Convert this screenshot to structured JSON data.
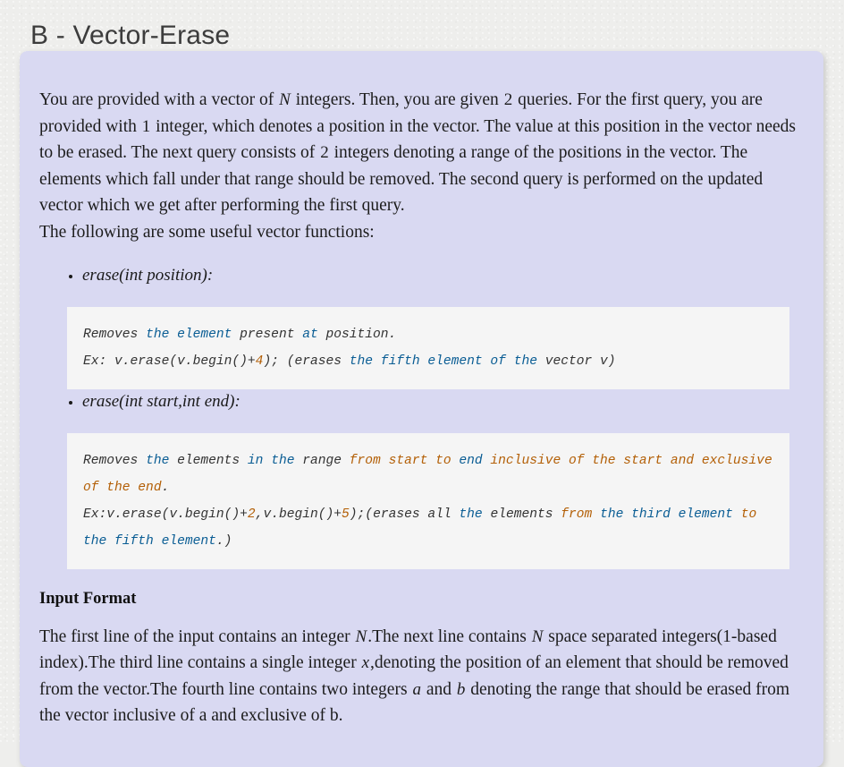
{
  "page": {
    "title": "B - Vector-Erase",
    "background_color": "#eeeeec",
    "panel_color": "#d9d9f2",
    "code_block_color": "#f5f5f5",
    "code_keyword_blue": "#0a5d94",
    "code_keyword_orange": "#b35f06"
  },
  "statement": {
    "p1_a": "You are provided with a vector of ",
    "p1_N": "N",
    "p1_b": " integers. Then, you are given ",
    "p1_2": "2",
    "p1_c": " queries. For the first query, you are provided with ",
    "p1_1": "1",
    "p1_d": " integer, which denotes a position in the vector. The value at this position in the vector needs to be erased. The next query consists of ",
    "p1_2b": "2",
    "p1_e": " integers denoting a range of the positions in the vector. The elements which fall under that range should be removed. The second query is performed on the updated vector which we get after performing the first query.",
    "p2": "The following are some useful vector functions:"
  },
  "functions": [
    {
      "signature": "erase(int position):",
      "code_lines": [
        [
          {
            "t": "Removes ",
            "c": "plain"
          },
          {
            "t": "the element ",
            "c": "blue"
          },
          {
            "t": "present ",
            "c": "plain"
          },
          {
            "t": "at ",
            "c": "blue"
          },
          {
            "t": "position.",
            "c": "plain"
          }
        ],
        [
          {
            "t": "Ex: v.erase(v.begin()+",
            "c": "plain"
          },
          {
            "t": "4",
            "c": "orange"
          },
          {
            "t": "); (erases ",
            "c": "plain"
          },
          {
            "t": "the fifth element of the ",
            "c": "blue"
          },
          {
            "t": "vector v)",
            "c": "plain"
          }
        ]
      ]
    },
    {
      "signature": "erase(int start,int end):",
      "code_lines": [
        [
          {
            "t": "Removes ",
            "c": "plain"
          },
          {
            "t": "the ",
            "c": "blue"
          },
          {
            "t": "elements ",
            "c": "plain"
          },
          {
            "t": "in the ",
            "c": "blue"
          },
          {
            "t": "range ",
            "c": "plain"
          },
          {
            "t": "from start to ",
            "c": "orange"
          },
          {
            "t": "end ",
            "c": "blue"
          },
          {
            "t": "inclusive of the start and exclusive of the end",
            "c": "orange"
          },
          {
            "t": ".",
            "c": "plain"
          }
        ],
        [
          {
            "t": "Ex:v.erase(v.begin()+",
            "c": "plain"
          },
          {
            "t": "2",
            "c": "orange"
          },
          {
            "t": ",v.begin()+",
            "c": "plain"
          },
          {
            "t": "5",
            "c": "orange"
          },
          {
            "t": ");(erases all ",
            "c": "plain"
          },
          {
            "t": "the ",
            "c": "blue"
          },
          {
            "t": "elements ",
            "c": "plain"
          },
          {
            "t": "from ",
            "c": "orange"
          },
          {
            "t": "the third element ",
            "c": "blue"
          },
          {
            "t": "to ",
            "c": "orange"
          },
          {
            "t": "the fifth element",
            "c": "blue"
          },
          {
            "t": ".)",
            "c": "plain"
          }
        ]
      ]
    }
  ],
  "input_format": {
    "heading": "Input Format",
    "a": "The first line of the input contains an integer ",
    "N1": "N",
    "b": ".The next line contains ",
    "N2": "N",
    "c": " space separated integers(1-based index).The third line contains a single integer ",
    "x": "x",
    "d": ",denoting the position of an element that should be removed from the vector.The fourth line contains two integers ",
    "a_var": "a",
    "e": " and ",
    "b_var": "b",
    "f": " denoting the range that should be erased from the vector inclusive of a and exclusive of b."
  }
}
